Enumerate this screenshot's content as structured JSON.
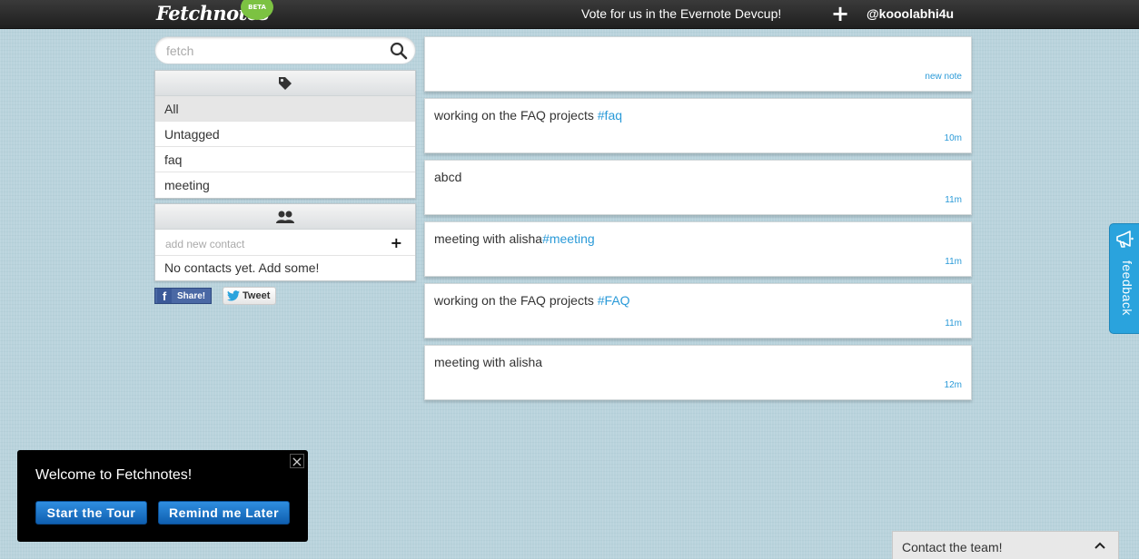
{
  "header": {
    "logo_text": "Fetchnotes",
    "beta_badge": "BETA",
    "vote_text": "Vote for us in the Evernote Devcup!",
    "add_label": "+",
    "username": "@kooolabhi4u"
  },
  "sidebar": {
    "search_placeholder": "fetch",
    "tags": [
      {
        "label": "All",
        "selected": true
      },
      {
        "label": "Untagged"
      },
      {
        "label": "faq"
      },
      {
        "label": "meeting"
      }
    ],
    "contacts": {
      "add_placeholder": "add new contact",
      "add_label": "+",
      "empty_text": "No contacts yet. Add some!"
    },
    "share": {
      "facebook_label": "Share!",
      "facebook_letter": "f",
      "twitter_label": "Tweet"
    }
  },
  "main": {
    "new_note_label": "new note",
    "notes": [
      {
        "text": "working on the FAQ projects ",
        "hashtag": "#faq",
        "time": "10m"
      },
      {
        "text": "abcd",
        "hashtag": "",
        "time": "11m"
      },
      {
        "text": "meeting with alisha",
        "hashtag": "#meeting",
        "time": "11m"
      },
      {
        "text": "working on the FAQ projects ",
        "hashtag": "#FAQ",
        "time": "11m"
      },
      {
        "text": "meeting with alisha",
        "hashtag": "",
        "time": "12m"
      }
    ]
  },
  "feedback": {
    "label": "feedback"
  },
  "welcome": {
    "title": "Welcome to Fetchnotes!",
    "close_label": "×",
    "tour_button": "Start the Tour",
    "later_button": "Remind me Later"
  },
  "contact_team": {
    "label": "Contact the team!"
  },
  "colors": {
    "accent": "#2a9ad8",
    "topbar": "#2a2a2a",
    "background": "#b9d3dc",
    "feedback_tab": "#2aa3dd",
    "beta_badge": "#7cc242"
  }
}
